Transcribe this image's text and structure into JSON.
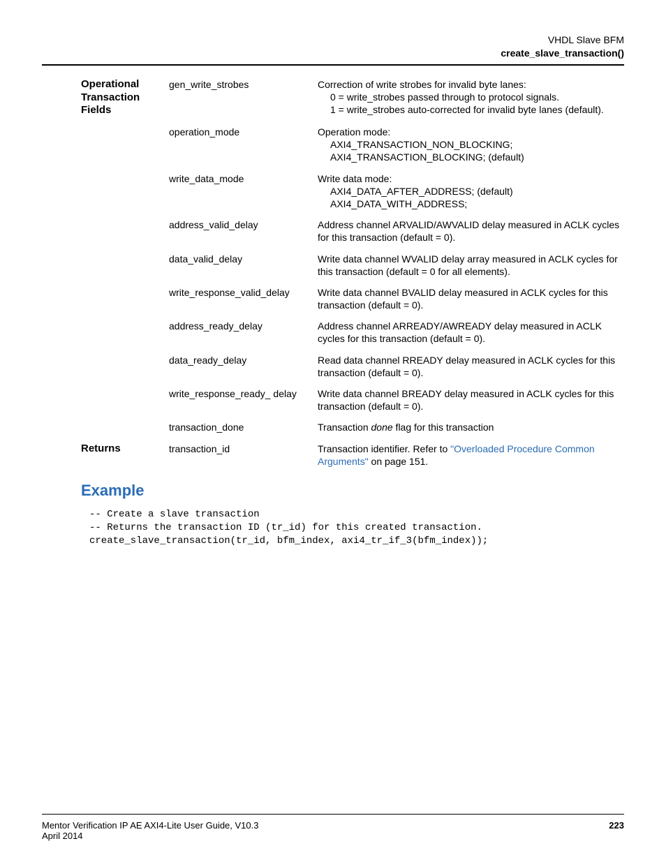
{
  "header": {
    "line1": "VHDL Slave BFM",
    "line2": "create_slave_transaction()"
  },
  "sections": {
    "op_fields_label": "Operational Transaction Fields",
    "returns_label": "Returns",
    "example_heading": "Example"
  },
  "fields": {
    "gen_write_strobes": {
      "name": "gen_write_strobes",
      "desc_intro": "Correction of write strobes for invalid byte lanes:",
      "desc_0": "0 = write_strobes passed through to protocol signals.",
      "desc_1": "1 = write_strobes auto-corrected for invalid byte lanes (default)."
    },
    "operation_mode": {
      "name": "operation_mode",
      "desc_intro": "Operation mode:",
      "opt1": "AXI4_TRANSACTION_NON_BLOCKING;",
      "opt2": "AXI4_TRANSACTION_BLOCKING; (default)"
    },
    "write_data_mode": {
      "name": "write_data_mode",
      "desc_intro": "Write data mode:",
      "opt1": "AXI4_DATA_AFTER_ADDRESS; (default)",
      "opt2": "AXI4_DATA_WITH_ADDRESS;"
    },
    "address_valid_delay": {
      "name": "address_valid_delay",
      "desc": "Address channel ARVALID/AWVALID delay measured in ACLK cycles for this transaction (default = 0)."
    },
    "data_valid_delay": {
      "name": "data_valid_delay",
      "desc": "Write data channel WVALID delay array measured in ACLK cycles for this transaction (default = 0 for all elements)."
    },
    "write_response_valid_delay": {
      "name": "write_response_valid_delay",
      "desc": "Write data channel BVALID delay measured in ACLK cycles for this transaction (default = 0)."
    },
    "address_ready_delay": {
      "name": "address_ready_delay",
      "desc": "Address channel ARREADY/AWREADY delay measured in ACLK cycles for this transaction (default = 0)."
    },
    "data_ready_delay": {
      "name": "data_ready_delay",
      "desc": "Read data channel RREADY delay measured in ACLK cycles for this transaction (default = 0)."
    },
    "write_response_ready_delay": {
      "name": "write_response_ready_ delay",
      "desc": "Write data channel BREADY delay measured in ACLK cycles for this transaction (default = 0)."
    },
    "transaction_done": {
      "name": "transaction_done",
      "desc_pre": "Transaction ",
      "desc_em": "done",
      "desc_post": " flag for this transaction"
    },
    "transaction_id": {
      "name": "transaction_id",
      "desc_pre": "Transaction identifier. Refer to ",
      "link_text": "\"Overloaded Procedure Common Arguments\"",
      "desc_post": " on page 151."
    }
  },
  "code": "-- Create a slave transaction\n-- Returns the transaction ID (tr_id) for this created transaction.\ncreate_slave_transaction(tr_id, bfm_index, axi4_tr_if_3(bfm_index));",
  "footer": {
    "left1": "Mentor Verification IP AE AXI4-Lite User Guide, V10.3",
    "left2": "April 2014",
    "page": "223"
  }
}
